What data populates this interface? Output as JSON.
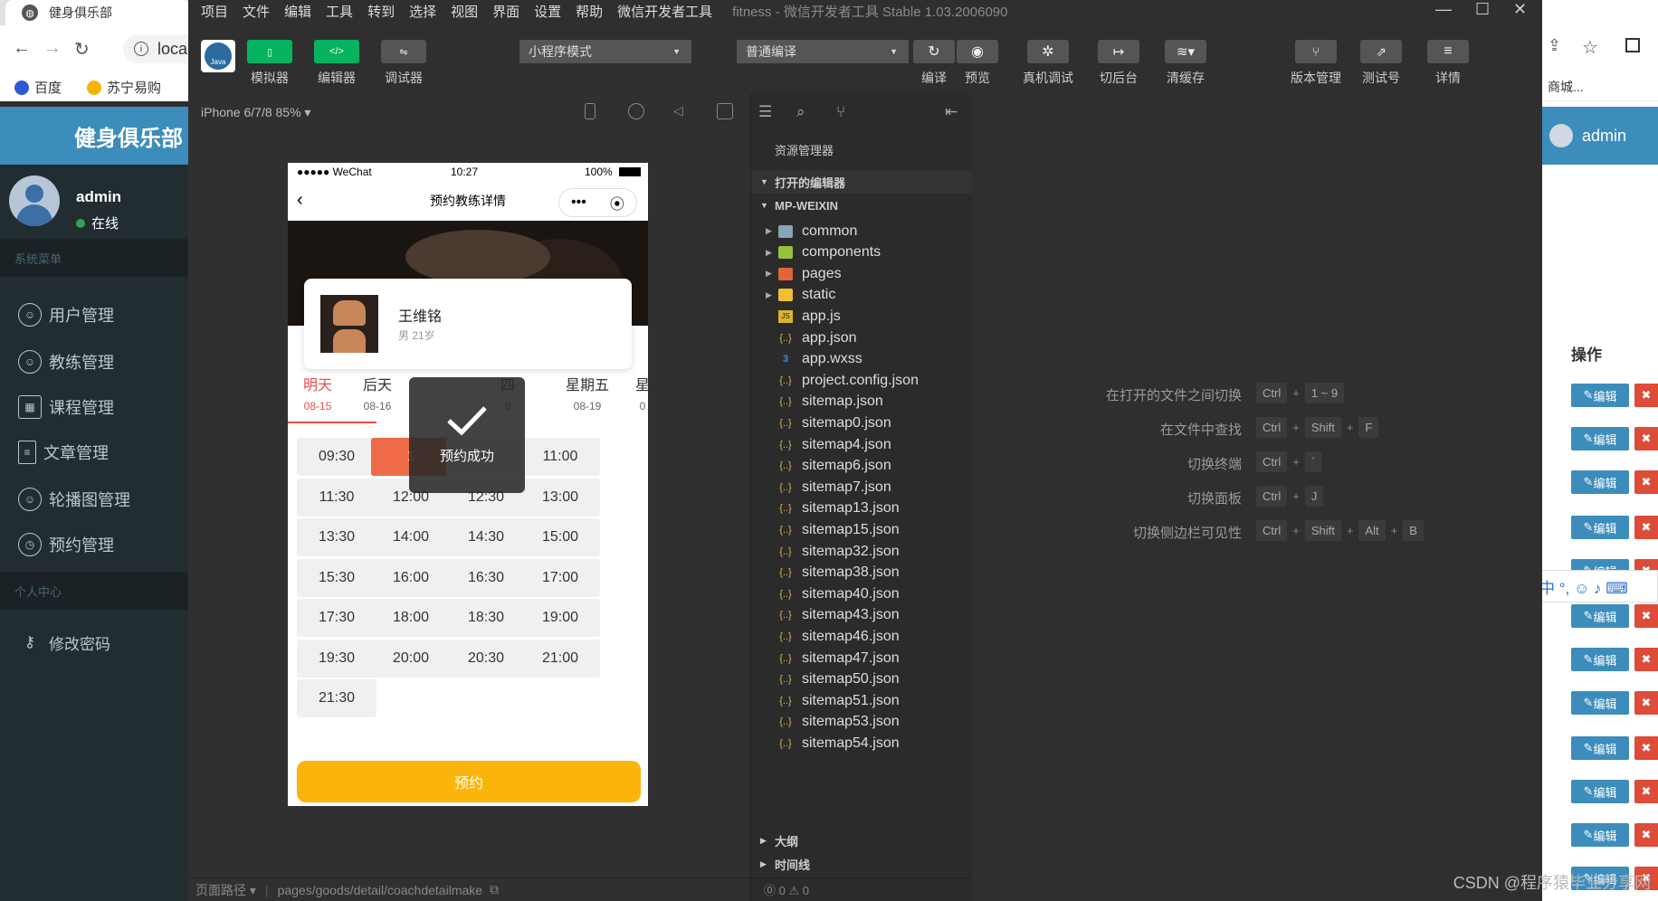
{
  "browser": {
    "tab_title": "健身俱乐部",
    "url_partial": "loca",
    "bookmarks": [
      "百度",
      "苏宁易购"
    ],
    "right_bookmark": "商城..."
  },
  "admin": {
    "brand": "健身俱乐部",
    "user_name": "admin",
    "status": "在线",
    "section_system": "系统菜单",
    "menu": [
      "用户管理",
      "教练管理",
      "课程管理",
      "文章管理",
      "轮播图管理",
      "预约管理"
    ],
    "section_personal": "个人中心",
    "personal_menu": [
      "修改密码"
    ],
    "right_user": "admin",
    "ops_header": "操作",
    "edit_label": "编辑",
    "delete_label": "✖"
  },
  "devtools": {
    "menu": [
      "项目",
      "文件",
      "编辑",
      "工具",
      "转到",
      "选择",
      "视图",
      "界面",
      "设置",
      "帮助",
      "微信开发者工具"
    ],
    "window_title": "fitness - 微信开发者工具 Stable 1.03.2006090",
    "toolbar": {
      "simulator": "模拟器",
      "editor": "编辑器",
      "debugger": "调试器",
      "mode_select": "小程序模式",
      "compile_select": "普通编译",
      "compile": "编译",
      "preview": "预览",
      "remote_debug": "真机调试",
      "background": "切后台",
      "clear_cache": "清缓存",
      "version": "版本管理",
      "test": "测试号",
      "details": "详情"
    },
    "device": "iPhone 6/7/8 85% ▾",
    "page_path_label": "页面路径 ▾",
    "page_path": "pages/goods/detail/coachdetailmake",
    "explorer": {
      "title": "资源管理器",
      "open_editors": "打开的编辑器",
      "root": "MP-WEIXIN",
      "folders": [
        "common",
        "components",
        "pages",
        "static"
      ],
      "files": [
        "app.js",
        "app.json",
        "app.wxss",
        "project.config.json",
        "sitemap.json",
        "sitemap0.json",
        "sitemap4.json",
        "sitemap6.json",
        "sitemap7.json",
        "sitemap13.json",
        "sitemap15.json",
        "sitemap32.json",
        "sitemap38.json",
        "sitemap40.json",
        "sitemap43.json",
        "sitemap46.json",
        "sitemap47.json",
        "sitemap50.json",
        "sitemap51.json",
        "sitemap53.json",
        "sitemap54.json"
      ],
      "outline": "大纲",
      "timeline": "时间线",
      "problems": "⓪ 0 ⚠ 0"
    },
    "shortcuts": [
      {
        "label": "在打开的文件之间切换",
        "keys": [
          "Ctrl",
          "1 ~ 9"
        ]
      },
      {
        "label": "在文件中查找",
        "keys": [
          "Ctrl",
          "Shift",
          "F"
        ]
      },
      {
        "label": "切换终端",
        "keys": [
          "Ctrl",
          "`"
        ]
      },
      {
        "label": "切换面板",
        "keys": [
          "Ctrl",
          "J"
        ]
      },
      {
        "label": "切换侧边栏可见性",
        "keys": [
          "Ctrl",
          "Shift",
          "Alt",
          "B"
        ]
      }
    ]
  },
  "phone": {
    "carrier": "●●●●● WeChat",
    "time": "10:27",
    "battery": "100%",
    "nav_title": "预约教练详情",
    "coach_name": "王维铭",
    "coach_info": "男  21岁",
    "days": [
      {
        "day": "明天",
        "date": "08-15"
      },
      {
        "day": "后天",
        "date": "08-16"
      },
      {
        "day": "四",
        "date": "8"
      },
      {
        "day": "星期五",
        "date": "08-19"
      },
      {
        "day": "星",
        "date": "0"
      }
    ],
    "slots": [
      "09:30",
      "1",
      "0",
      "11:00",
      "11:30",
      "12:00",
      "12:30",
      "13:00",
      "13:30",
      "14:00",
      "14:30",
      "15:00",
      "15:30",
      "16:00",
      "16:30",
      "17:00",
      "17:30",
      "18:00",
      "18:30",
      "19:00",
      "19:30",
      "20:00",
      "20:30",
      "21:00",
      "21:30"
    ],
    "book_button": "预约",
    "toast": "预约成功"
  },
  "watermark": "CSDN @程序猿毕业分享网"
}
